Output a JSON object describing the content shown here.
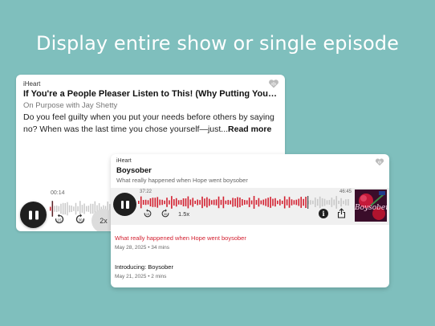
{
  "headline": "Display entire show or single episode",
  "show_card": {
    "brand": "iHeart",
    "title": "If You're a People Pleaser Listen to This! (Why Putting Yoursel...",
    "show_name": "On Purpose with Jay Shetty",
    "description": "Do you feel guilty when you put your needs before others by saying no? When was the last time you chose yourself—just...",
    "read_more": "Read more",
    "elapsed": "00:14",
    "speed": "2x",
    "icons": {
      "logo": "iheart-logo-icon",
      "play": "pause-icon",
      "rewind": "rewind-15-icon",
      "forward": "forward-30-icon"
    }
  },
  "episode_card": {
    "brand": "iHeart",
    "show_title": "Boysober",
    "episode_subtitle": "What really happened when Hope went boysober",
    "elapsed": "37:22",
    "duration": "46:45",
    "progress": 0.8,
    "speed": "1.5x",
    "artwork_label": "Boysober",
    "info_label": "i",
    "icons": {
      "logo": "iheart-logo-icon",
      "play": "pause-icon",
      "rewind": "rewind-15-icon",
      "forward": "forward-30-icon",
      "info": "info-icon",
      "share": "share-icon"
    },
    "accent": "#d32030",
    "episodes": [
      {
        "title": "What really happened when Hope went boysober",
        "meta": "May 28, 2025 • 34 mins",
        "active": true
      },
      {
        "title": "Introducing: Boysober",
        "meta": "May 21, 2025 • 2 mins",
        "active": false
      }
    ]
  }
}
